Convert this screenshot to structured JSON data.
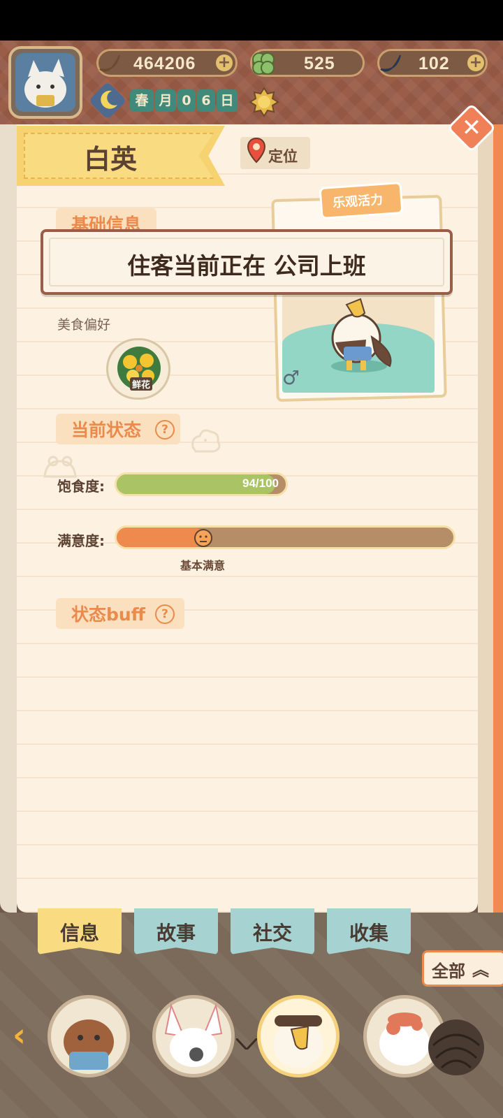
{
  "hud": {
    "banana": "464206",
    "clover": "525",
    "blue_banana": "102",
    "season_label": "春",
    "month_label": "月",
    "day_digits": [
      "0",
      "6"
    ],
    "day_label": "日"
  },
  "resident": {
    "name": "白英",
    "locate_label": "定位",
    "trait": "乐观活力",
    "gender_symbol": "♂"
  },
  "sections": {
    "basic_info": "基础信息",
    "food_pref_label": "美食偏好",
    "food_pref_item": "鲜花",
    "current_status": "当前状态",
    "buff": "状态buff"
  },
  "popup": {
    "text": "住客当前正在 公司上班"
  },
  "status": {
    "satiety_label": "饱食度:",
    "satiety_value": 94,
    "satiety_max": 100,
    "satiety_text": "94/100",
    "satisfaction_label": "满意度:",
    "satisfaction_fraction": 0.26,
    "satisfaction_text": "基本满意"
  },
  "tabs": [
    "信息",
    "故事",
    "社交",
    "收集"
  ],
  "all_button": "全部",
  "colors": {
    "accent_orange": "#ea8a4b",
    "satiety_fill": "#a9c365",
    "satisfaction_fill": "#ef8a4f",
    "tab_active": "#f9dc82",
    "tab_inactive": "#a6d2d2"
  },
  "icons": [
    "banana-icon",
    "clover-icon",
    "blue-banana-icon",
    "moon-icon",
    "sun-icon",
    "close-icon",
    "location-pin-icon",
    "help-icon",
    "male-icon",
    "chevron-left-icon",
    "chevron-right-icon",
    "double-chevron-up-icon"
  ]
}
